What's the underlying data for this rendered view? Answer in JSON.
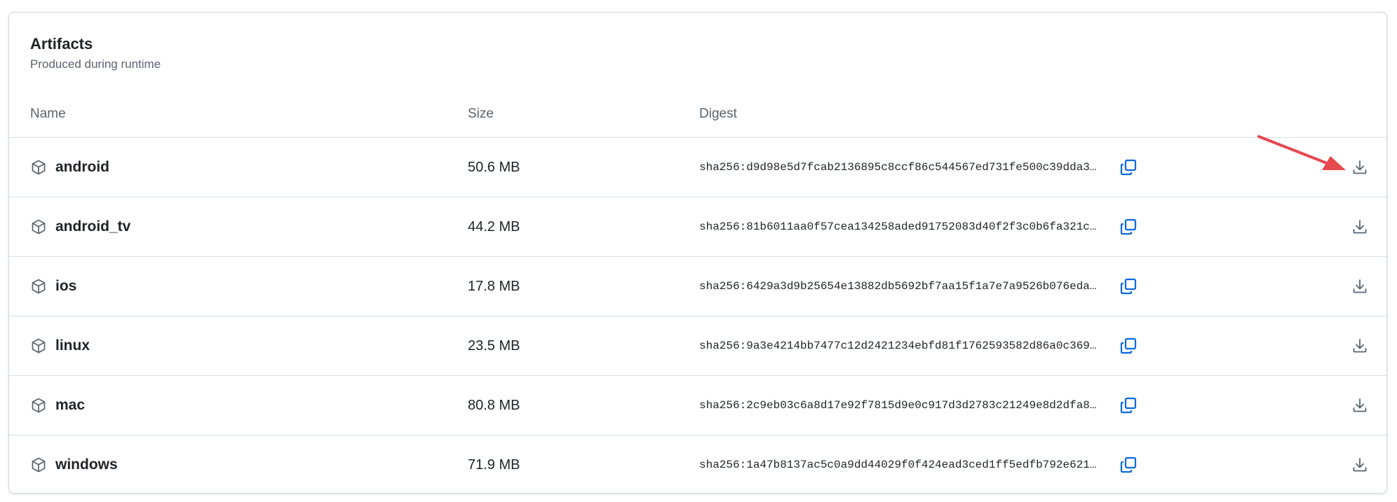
{
  "card": {
    "title": "Artifacts",
    "subtitle": "Produced during runtime"
  },
  "columns": {
    "name": "Name",
    "size": "Size",
    "digest": "Digest"
  },
  "artifacts": [
    {
      "name": "android",
      "size": "50.6 MB",
      "digest": "sha256:d9d98e5d7fcab2136895c8ccf86c544567ed731fe500c39dda3…"
    },
    {
      "name": "android_tv",
      "size": "44.2 MB",
      "digest": "sha256:81b6011aa0f57cea134258aded91752083d40f2f3c0b6fa321c…"
    },
    {
      "name": "ios",
      "size": "17.8 MB",
      "digest": "sha256:6429a3d9b25654e13882db5692bf7aa15f1a7e7a9526b076eda…"
    },
    {
      "name": "linux",
      "size": "23.5 MB",
      "digest": "sha256:9a3e4214bb7477c12d2421234ebfd81f1762593582d86a0c369…"
    },
    {
      "name": "mac",
      "size": "80.8 MB",
      "digest": "sha256:2c9eb03c6a8d17e92f7815d9e0c917d3d2783c21249e8d2dfa8…"
    },
    {
      "name": "windows",
      "size": "71.9 MB",
      "digest": "sha256:1a47b8137ac5c0a9dd44029f0f424ead3ced1ff5edfb792e621…"
    }
  ],
  "icons": {
    "row": "package-icon",
    "copy": "copy-icon",
    "download": "download-icon",
    "annotation": "arrow-annotation"
  },
  "colors": {
    "accent": "#0969da",
    "annotation": "#e5484d",
    "muted": "#59636e"
  }
}
